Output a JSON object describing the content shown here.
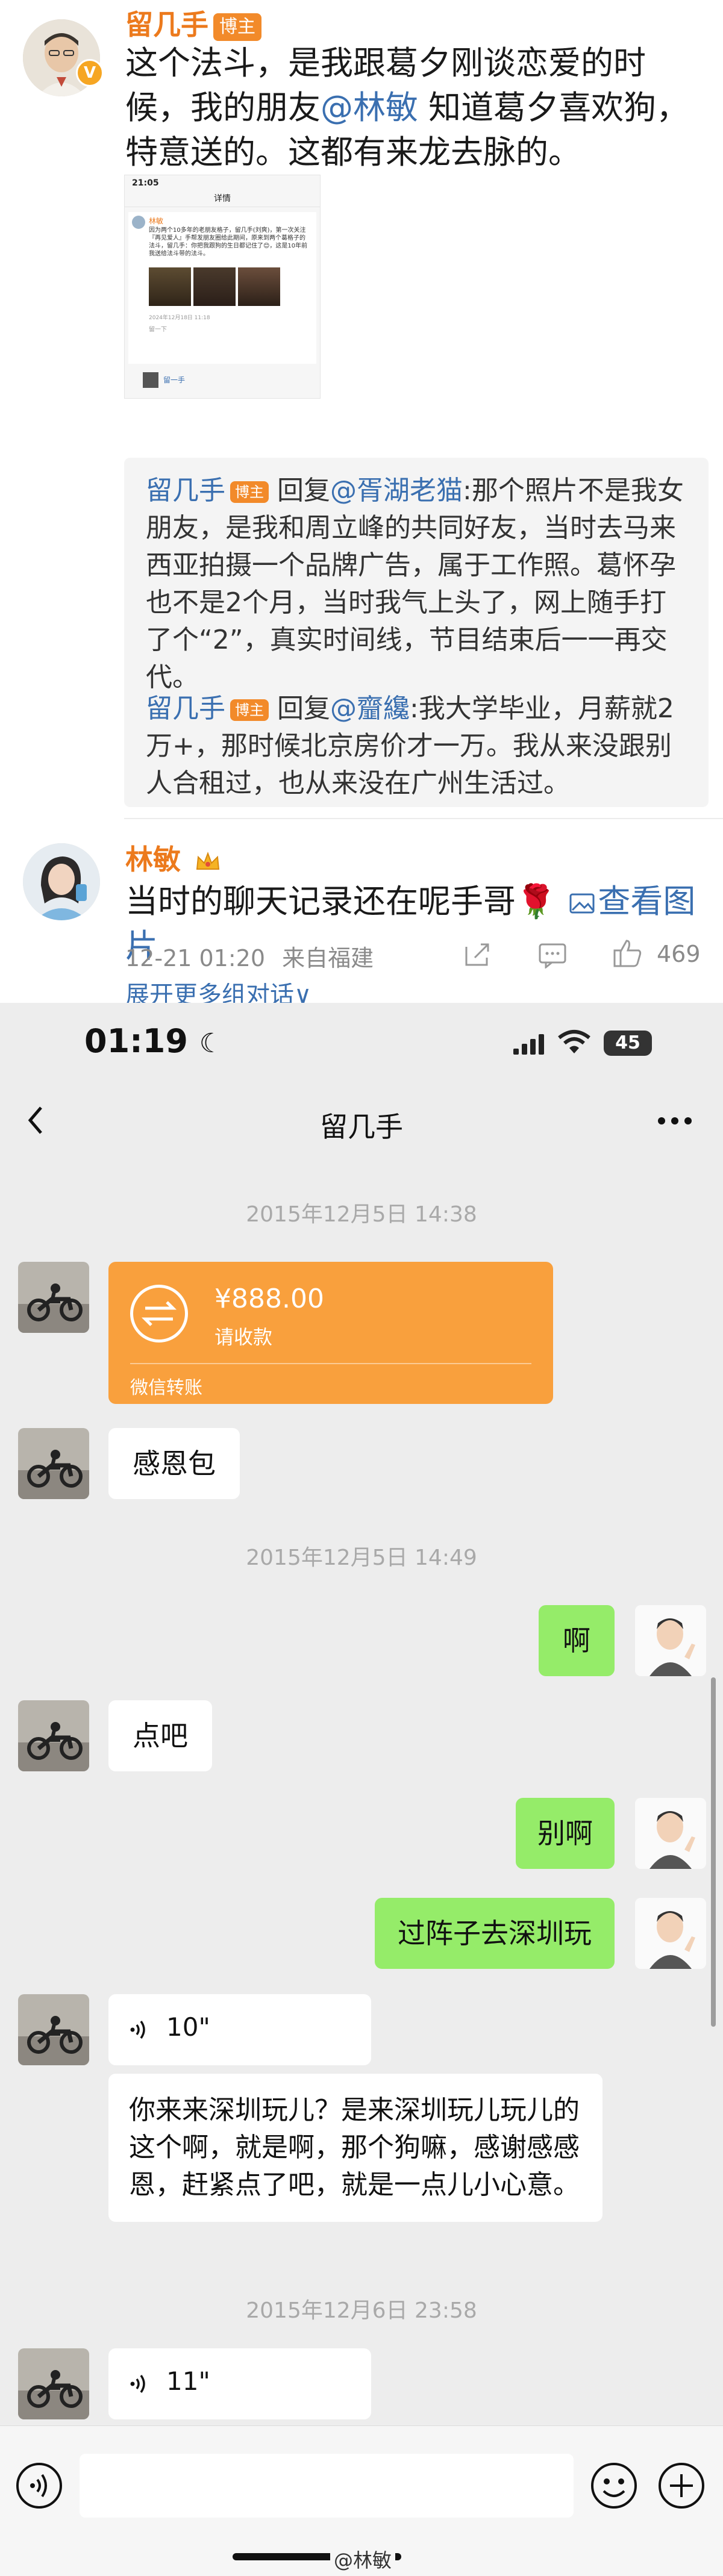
{
  "weibo": {
    "post": {
      "author": "留几手",
      "badge": "博主",
      "text_pre": "这个法斗，是我跟葛夕刚谈恋爱的时候，我的朋友",
      "mention": "@林敏",
      "text_post": " 知道葛夕喜欢狗，特意送的。这都有来龙去脉的。"
    },
    "screenshot": {
      "time": "21:05",
      "title": "详情",
      "author": "林敏",
      "text": "因为两个10多年的老朋友格子，留几手(刘爽)，第一次关注『再见爱人』手帮发朋友圈给此期间，原来到两个葛格子的法斗，留几手：你把我跟狗的生日都记住了😊，这是10年前我送给法斗带的法斗。",
      "date": "2024年12月18日 11:18",
      "comment_hint": "留一下",
      "reply_user": "留一手"
    },
    "replies": [
      {
        "user": "留几手",
        "badge": "博主",
        "reply_word": " 回复",
        "target": "@胥湖老猫",
        "text": ":那个照片不是我女朋友，是我和周立峰的共同好友，当时去马来西亚拍摄一个品牌广告，属于工作照。葛怀孕也不是2个月，当时我气上头了，网上随手打了个“2”，真实时间线，节目结束后一一再交代。"
      },
      {
        "user": "留几手",
        "badge": "博主",
        "reply_word": " 回复",
        "target": "@齏纔",
        "text": ":我大学毕业，月薪就2万+，那时候北京房价才一万。我从来没跟别人合租过，也从来没在广州生活过。"
      }
    ],
    "comment": {
      "user": "林敏",
      "text": "当时的聊天记录还在呢手哥🌹",
      "view_image": "查看图片",
      "time": "12-21 01:20",
      "location": "来自福建",
      "likes": "469",
      "expand": "展开更多组对话∨"
    }
  },
  "chat": {
    "status_time": "01:19",
    "battery": "45",
    "title": "留几手",
    "messages": {
      "ts1": "2015年12月5日 14:38",
      "transfer_amount": "¥888.00",
      "transfer_status": "请收款",
      "transfer_label": "微信转账",
      "m_thanks": "感恩包",
      "ts2": "2015年12月5日 14:49",
      "m_ah": "啊",
      "m_dianba": "点吧",
      "m_bie": "别啊",
      "m_shenzhen": "过阵子去深圳玩",
      "voice1": "10\"",
      "voice1_text": "你来来深圳玩儿？是来深圳玩儿玩儿的这个啊，就是啊，那个狗嘛，感谢感感恩，赶紧点了吧，就是一点儿小心意。",
      "ts3": "2015年12月6日 23:58",
      "voice2": "11\""
    },
    "watermark": "@林敏"
  }
}
